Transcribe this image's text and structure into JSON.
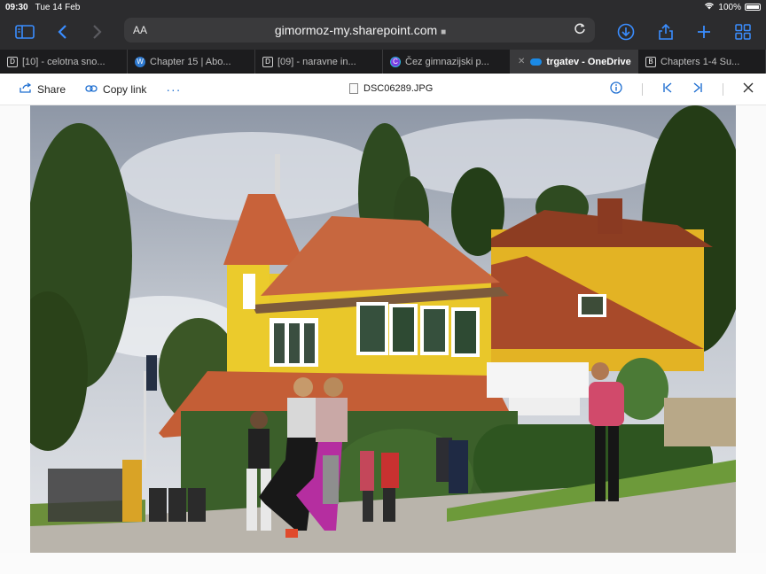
{
  "status": {
    "time": "09:30",
    "date": "Tue 14 Feb",
    "battery": "100%"
  },
  "address": {
    "aa": "AA",
    "url": "gimormoz-my.sharepoint.com",
    "lock": "🔒"
  },
  "tabs": [
    {
      "label": "[10] - celotna sno...",
      "fav": "D",
      "active": false
    },
    {
      "label": "Chapter 15 | Abo...",
      "fav": "W",
      "active": false
    },
    {
      "label": "[09] - naravne in...",
      "fav": "D",
      "active": false
    },
    {
      "label": "Čez gimnazijski p...",
      "fav": "C",
      "active": false
    },
    {
      "label": "trgatev - OneDrive",
      "fav": "",
      "active": true
    },
    {
      "label": "Chapters 1-4 Su...",
      "fav": "B",
      "active": false
    }
  ],
  "cmd": {
    "share": "Share",
    "copy_link": "Copy link",
    "more": "···",
    "filename": "DSC06289.JPG"
  },
  "colors": {
    "accent": "#1f6fd1",
    "ios_blue": "#3a8dff"
  },
  "icons": [
    "sidebar-icon",
    "back-icon",
    "forward-icon",
    "reload-icon",
    "download-icon",
    "share-icon",
    "new-tab-icon",
    "tabs-grid-icon",
    "info-icon",
    "previous-icon",
    "next-icon",
    "close-icon"
  ]
}
